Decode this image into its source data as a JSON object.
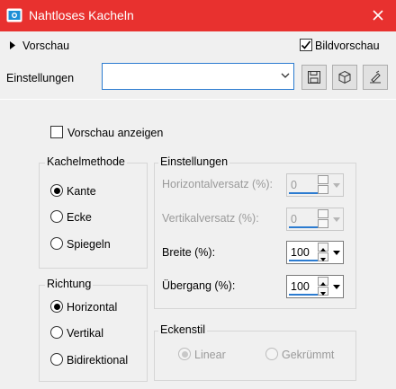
{
  "window": {
    "title": "Nahtloses Kacheln"
  },
  "preview": {
    "toggle_label": "Vorschau",
    "bildvorschau_label": "Bildvorschau",
    "bildvorschau_checked": true
  },
  "settings_row": {
    "label": "Einstellungen",
    "dropdown_value": ""
  },
  "show_preview": {
    "label": "Vorschau anzeigen",
    "checked": false
  },
  "kachelmethode": {
    "title": "Kachelmethode",
    "options": [
      {
        "label": "Kante",
        "selected": true
      },
      {
        "label": "Ecke",
        "selected": false
      },
      {
        "label": "Spiegeln",
        "selected": false
      }
    ]
  },
  "richtung": {
    "title": "Richtung",
    "options": [
      {
        "label": "Horizontal",
        "selected": true
      },
      {
        "label": "Vertikal",
        "selected": false
      },
      {
        "label": "Bidirektional",
        "selected": false
      }
    ]
  },
  "einstellungen": {
    "title": "Einstellungen",
    "fields": [
      {
        "label": "Horizontalversatz (%):",
        "value": "0",
        "enabled": false
      },
      {
        "label": "Vertikalversatz (%):",
        "value": "0",
        "enabled": false
      },
      {
        "label": "Breite (%):",
        "value": "100",
        "enabled": true
      },
      {
        "label": "Übergang (%):",
        "value": "100",
        "enabled": true
      }
    ]
  },
  "eckenstil": {
    "title": "Eckenstil",
    "options": [
      {
        "label": "Linear",
        "selected": true,
        "enabled": false
      },
      {
        "label": "Gekrümmt",
        "selected": false,
        "enabled": false
      }
    ]
  }
}
